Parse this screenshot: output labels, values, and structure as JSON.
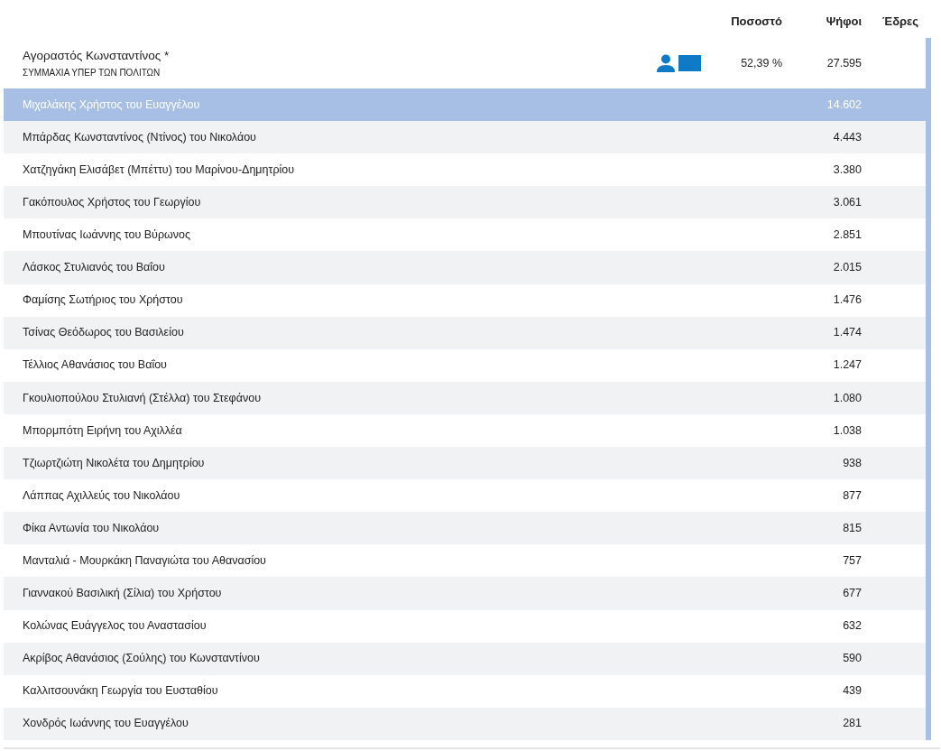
{
  "columns": [
    "Ποσοστό",
    "Ψήφοι",
    "Έδρες"
  ],
  "party": {
    "name": "Αγοραστός Κωνσταντίνος *",
    "alliance": "ΣΥΜΜΑΧΙΑ ΥΠΕΡ ΤΩΝ ΠΟΛΙΤΩΝ",
    "percent": "52,39 %",
    "votes": "27.595"
  },
  "candidates": [
    {
      "name": "Μιχαλάκης Χρήστος του Ευαγγέλου",
      "votes": "14.602",
      "selected": true
    },
    {
      "name": "Μπάρδας Κωνσταντίνος (Ντίνος) του Νικολάου",
      "votes": "4.443",
      "selected": false
    },
    {
      "name": "Χατζηγάκη Ελισάβετ (Μπέττυ) του Μαρίνου-Δημητρίου",
      "votes": "3.380",
      "selected": false
    },
    {
      "name": "Γακόπουλος Χρήστος του Γεωργίου",
      "votes": "3.061",
      "selected": false
    },
    {
      "name": "Μπουτίνας Ιωάννης του Βύρωνος",
      "votes": "2.851",
      "selected": false
    },
    {
      "name": "Λάσκος Στυλιανός του Βαΐου",
      "votes": "2.015",
      "selected": false
    },
    {
      "name": "Φαμίσης Σωτήριος του Χρήστου",
      "votes": "1.476",
      "selected": false
    },
    {
      "name": "Τσίνας Θεόδωρος του Βασιλείου",
      "votes": "1.474",
      "selected": false
    },
    {
      "name": "Τέλλιος Αθανάσιος του Βαΐου",
      "votes": "1.247",
      "selected": false
    },
    {
      "name": "Γκουλιοπούλου Στυλιανή (Στέλλα) του Στεφάνου",
      "votes": "1.080",
      "selected": false
    },
    {
      "name": "Μπορμπότη Ειρήνη του Αχιλλέα",
      "votes": "1.038",
      "selected": false
    },
    {
      "name": "Τζιωρτζιώτη Νικολέτα του Δημητρίου",
      "votes": "938",
      "selected": false
    },
    {
      "name": "Λάππας Αχιλλεύς του Νικολάου",
      "votes": "877",
      "selected": false
    },
    {
      "name": "Φίκα Αντωνία του Νικολάου",
      "votes": "815",
      "selected": false
    },
    {
      "name": "Μανταλιά - Μουρκάκη Παναγιώτα του Αθανασίου",
      "votes": "757",
      "selected": false
    },
    {
      "name": "Γιαννακού Βασιλική (Σίλια) του Χρήστου",
      "votes": "677",
      "selected": false
    },
    {
      "name": "Κολώνας Ευάγγελος του Αναστασίου",
      "votes": "632",
      "selected": false
    },
    {
      "name": "Ακρίβος Αθανάσιος (Σούλης) του Κωνσταντίνου",
      "votes": "590",
      "selected": false
    },
    {
      "name": "Καλλιτσουνάκη Γεωργία του Ευσταθίου",
      "votes": "439",
      "selected": false
    },
    {
      "name": "Χονδρός Ιωάννης του Ευαγγέλου",
      "votes": "281",
      "selected": false
    }
  ]
}
